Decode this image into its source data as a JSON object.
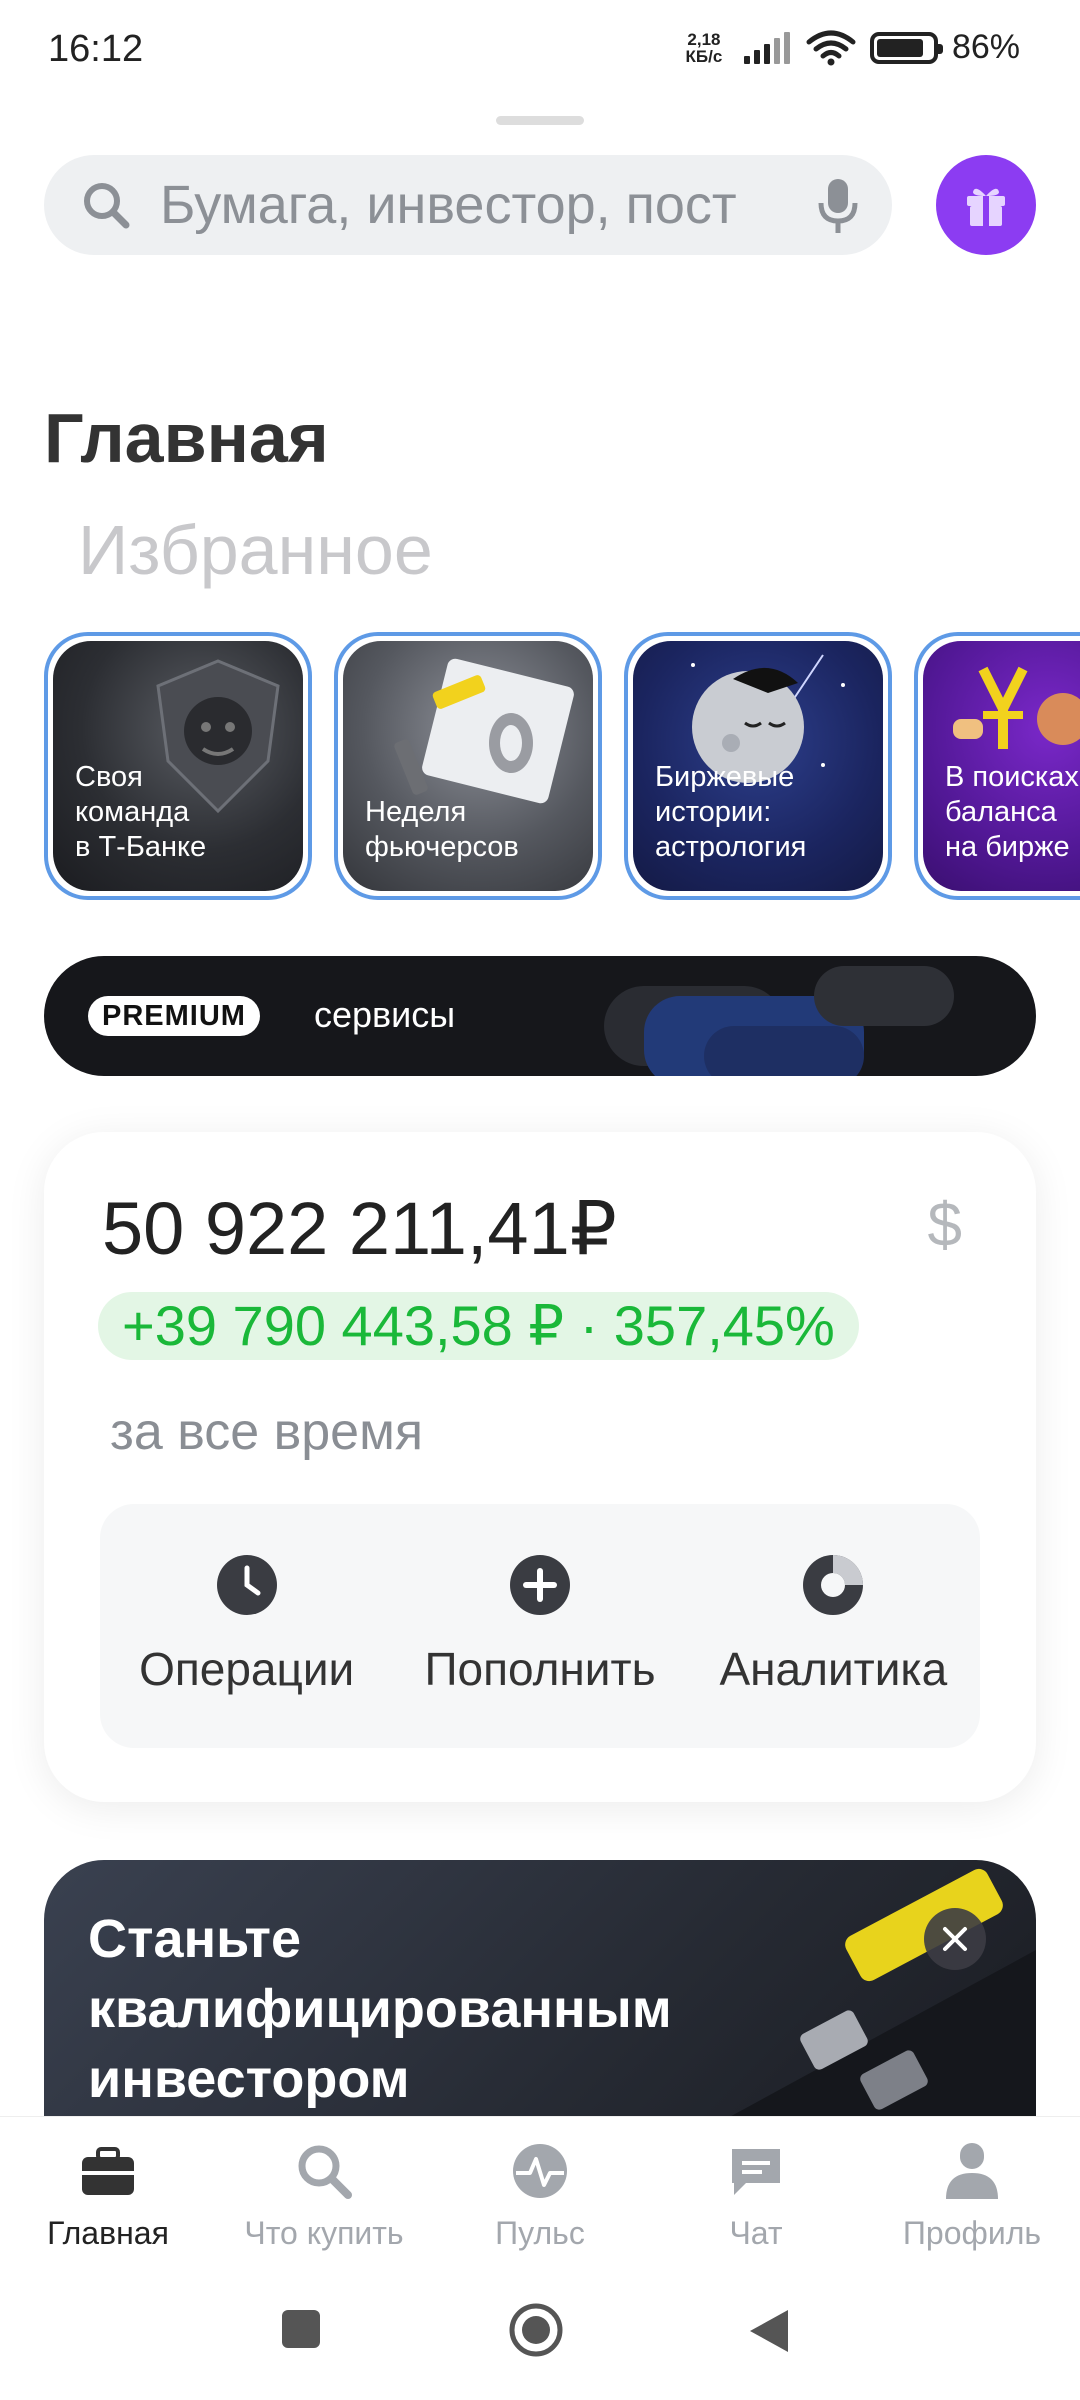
{
  "status_bar": {
    "time": "16:12",
    "net_speed_value": "2,18",
    "net_speed_unit": "КБ/с",
    "battery": "86%",
    "battery_level": 0.86
  },
  "search": {
    "placeholder": "Бумага, инвестор, пост",
    "search_icon": "search-icon",
    "mic_icon": "mic-icon"
  },
  "gift_button": {
    "icon": "gift-icon",
    "color": "#8c3cf2"
  },
  "tabs_header": {
    "main": "Главная",
    "favorites": "Избранное"
  },
  "stories": [
    {
      "text": "Своя\nкоманда\nв Т-Банке"
    },
    {
      "text": "Неделя\nфьючерсов"
    },
    {
      "text": "Биржевые\nистории:\nастрология"
    },
    {
      "text": "В поисках\nбаланса\nна бирже"
    }
  ],
  "premium": {
    "badge": "PREMIUM",
    "label": "сервисы"
  },
  "portfolio": {
    "amount": "50 922 211,41₽",
    "currency_symbol": "$",
    "change": "+39 790 443,58 ₽ · 357,45%",
    "period": "за все время",
    "actions": [
      {
        "label": "Операции",
        "icon": "clock-icon"
      },
      {
        "label": "Пополнить",
        "icon": "plus-icon"
      },
      {
        "label": "Аналитика",
        "icon": "donut-chart-icon"
      }
    ],
    "positive_color": "#1ab839"
  },
  "promo": {
    "text": "Станьте\nквалифицированным\nинвестором",
    "close_icon": "close-icon"
  },
  "tab_bar": {
    "items": [
      {
        "label": "Главная",
        "icon": "briefcase-icon",
        "active": true
      },
      {
        "label": "Что купить",
        "icon": "search-icon",
        "active": false
      },
      {
        "label": "Пульс",
        "icon": "pulse-icon",
        "active": false
      },
      {
        "label": "Чат",
        "icon": "chat-icon",
        "active": false
      },
      {
        "label": "Профиль",
        "icon": "profile-icon",
        "active": false
      }
    ]
  }
}
